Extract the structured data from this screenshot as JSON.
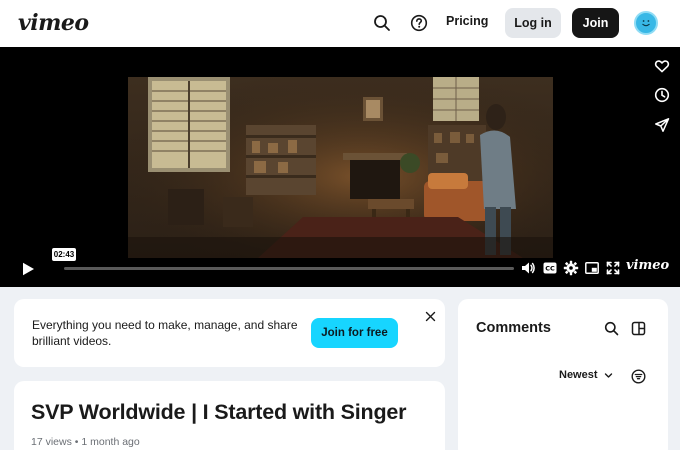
{
  "header": {
    "logo": "vimeo",
    "pricing_label": "Pricing",
    "login_label": "Log in",
    "join_label": "Join",
    "icons": [
      "search-icon",
      "help-icon",
      "avatar"
    ]
  },
  "player": {
    "time_tooltip": "02:43",
    "progress_fraction": 0.0,
    "brand_label": "vimeo",
    "side_actions": [
      "heart-icon",
      "clock-icon",
      "send-icon"
    ],
    "controls": [
      "volume-icon",
      "cc-icon",
      "settings-icon",
      "pip-icon",
      "fullscreen-icon"
    ]
  },
  "promo": {
    "text": "Everything you need to make, manage, and share brilliant videos.",
    "button_label": "Join for free"
  },
  "video": {
    "title": "SVP Worldwide | I Started with Singer",
    "meta": "17 views • 1 month ago"
  },
  "comments": {
    "title": "Comments",
    "sort_label": "Newest"
  },
  "colors": {
    "accent": "#17d5ff",
    "dark_button": "#161616",
    "avatar": "#39b8e6",
    "page_bg": "#eef1f5"
  }
}
